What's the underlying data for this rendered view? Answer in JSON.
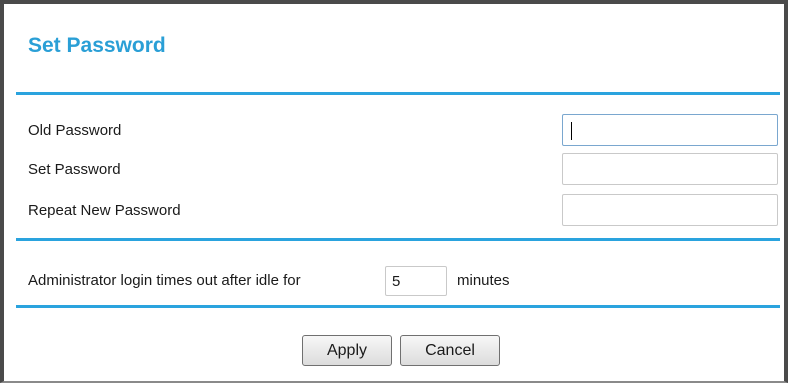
{
  "page": {
    "title": "Set Password",
    "accent_color": "#2aa3de"
  },
  "form": {
    "old_password_label": "Old Password",
    "set_password_label": "Set Password",
    "repeat_password_label": "Repeat New Password",
    "old_password_value": "",
    "set_password_value": "",
    "repeat_password_value": ""
  },
  "timeout": {
    "label": "Administrator login times out after idle for",
    "value": "5",
    "unit": "minutes"
  },
  "buttons": {
    "apply_label": "Apply",
    "cancel_label": "Cancel"
  }
}
